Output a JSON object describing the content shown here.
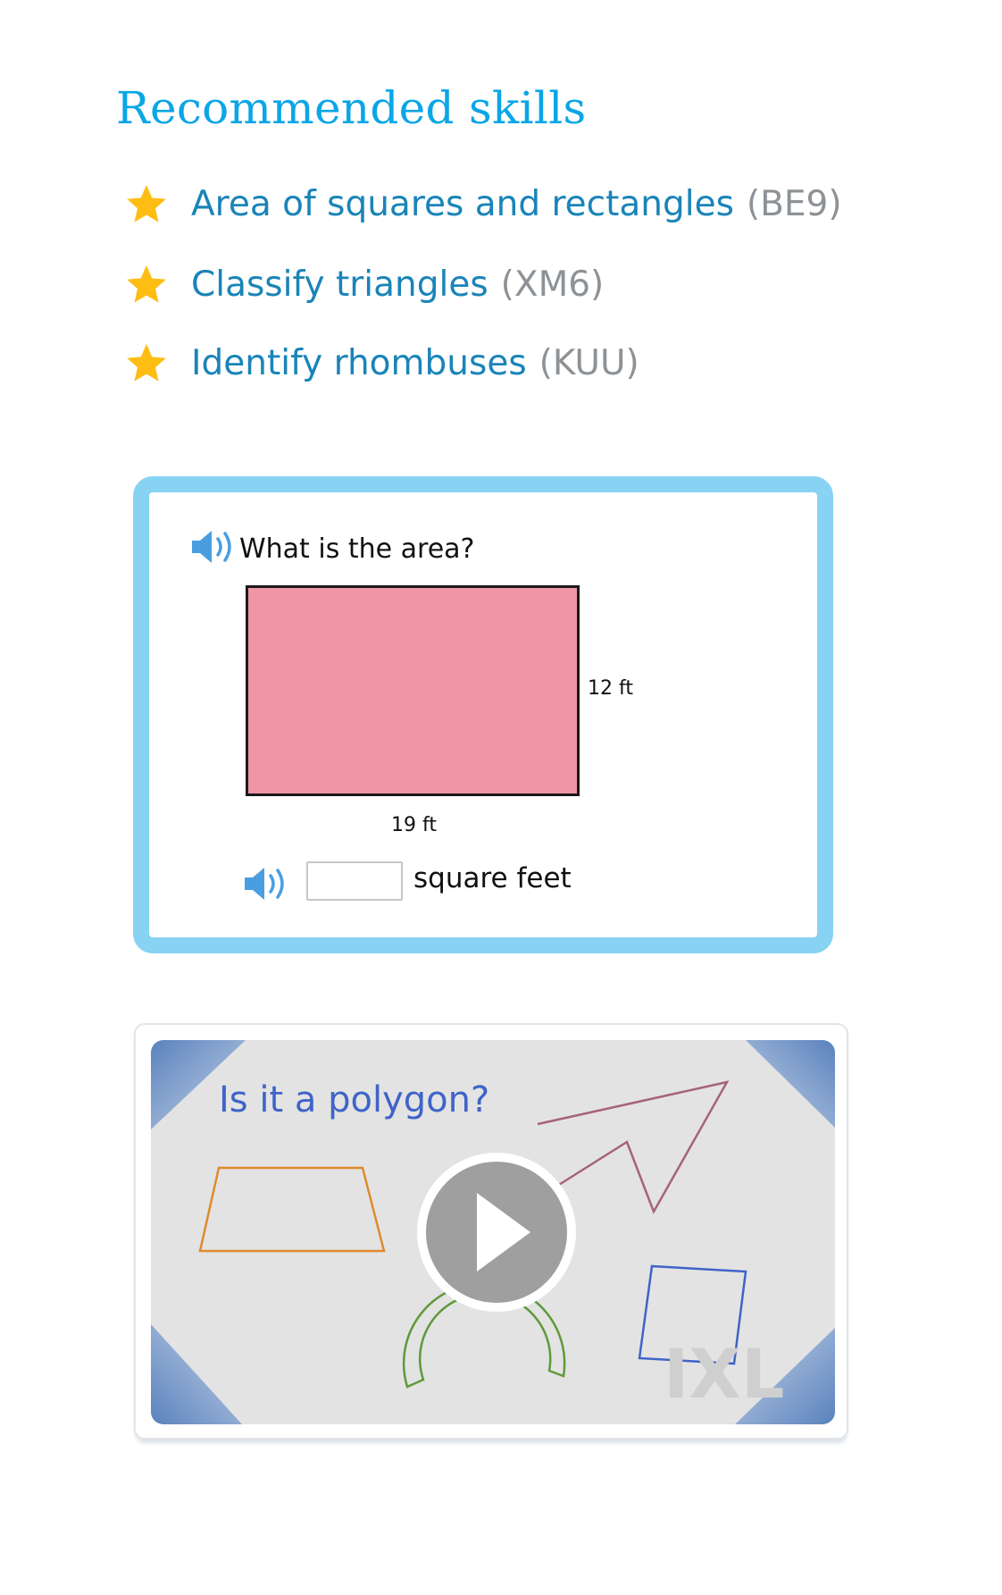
{
  "heading": "Recommended skills",
  "skills": [
    {
      "name": "Area of squares and rectangles",
      "code": "(BE9)"
    },
    {
      "name": "Classify triangles",
      "code": "(XM6)"
    },
    {
      "name": "Identify rhombuses",
      "code": "(KUU)"
    }
  ],
  "question": {
    "prompt": "What is the area?",
    "side_label": "12 ft",
    "bottom_label": "19 ft",
    "answer_value": "",
    "unit": "square feet"
  },
  "video": {
    "title": "Is it a polygon?",
    "watermark": "IXL"
  },
  "colors": {
    "heading": "#0aa6e6",
    "skill_link": "#1a84b8",
    "skill_code": "#8d9296",
    "star": "#fdbd13",
    "card_border": "#88d3f3",
    "rectangle_fill": "#ef95a5",
    "speaker": "#4a9ee0",
    "video_title": "#3f64c8"
  },
  "icons": [
    "star-icon",
    "speaker-icon",
    "play-icon"
  ]
}
